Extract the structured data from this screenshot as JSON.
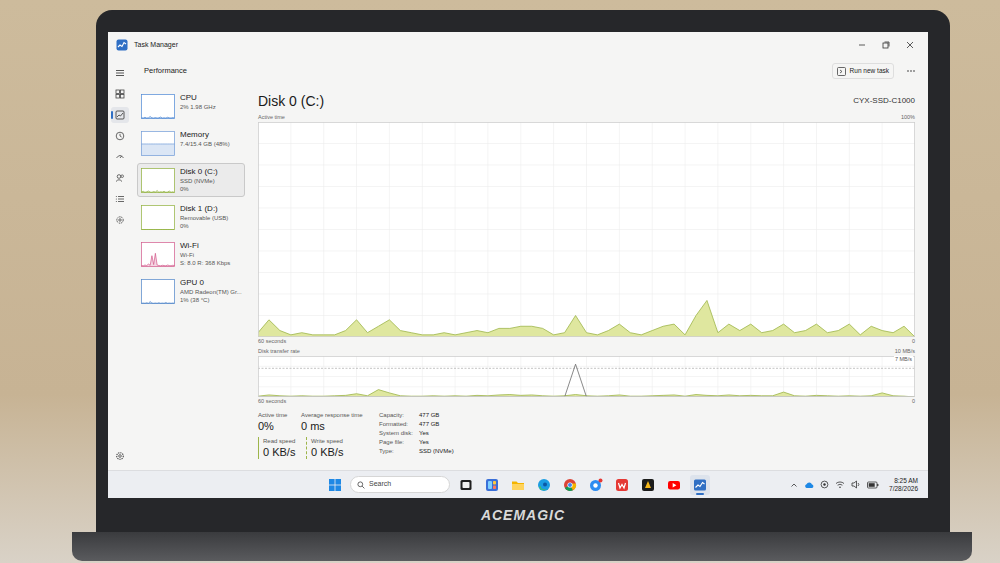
{
  "window": {
    "title": "Task Manager",
    "page": "Performance"
  },
  "nav": [
    {
      "selected": false
    },
    {
      "selected": false
    },
    {
      "selected": true
    },
    {
      "selected": false
    },
    {
      "selected": false
    },
    {
      "selected": false
    },
    {
      "selected": false
    },
    {
      "selected": false
    },
    {
      "selected": false
    }
  ],
  "toolbar": {
    "run_new_task": "Run new task"
  },
  "resources": [
    {
      "name": "CPU",
      "lines": [
        "2% 1.98 GHz"
      ],
      "selected": false,
      "color": "#4a86d4",
      "graph": [
        3,
        2,
        5,
        2,
        3,
        8,
        3,
        2,
        4,
        2,
        3,
        6,
        2,
        3,
        2,
        5,
        3,
        2,
        4,
        2
      ]
    },
    {
      "name": "Memory",
      "lines": [
        "7.4/15.4 GB (48%)"
      ],
      "selected": false,
      "color": "#6f9bd8",
      "graph": [
        48,
        48,
        48,
        48,
        48,
        48,
        48,
        48,
        48,
        48,
        48,
        48,
        48,
        48,
        48,
        48,
        48,
        48,
        48,
        48
      ]
    },
    {
      "name": "Disk 0 (C:)",
      "lines": [
        "SSD (NVMe)",
        "0%"
      ],
      "selected": true,
      "color": "#8fb03a",
      "graph": [
        2,
        5,
        1,
        3,
        6,
        2,
        1,
        4,
        2,
        8,
        1,
        3,
        2,
        5,
        1,
        2,
        6,
        1,
        3,
        0
      ]
    },
    {
      "name": "Disk 1 (D:)",
      "lines": [
        "Removable (USB)",
        "0%"
      ],
      "selected": false,
      "color": "#8fb03a",
      "graph": [
        0,
        0,
        0,
        0,
        0,
        0,
        0,
        0,
        0,
        0,
        0,
        0,
        0,
        0,
        0,
        0,
        0,
        0,
        0,
        0
      ]
    },
    {
      "name": "Wi-Fi",
      "lines": [
        "Wi-Fi",
        "S: 8.0 R: 368 Kbps"
      ],
      "selected": false,
      "color": "#d2578a",
      "graph": [
        4,
        3,
        6,
        4,
        10,
        5,
        45,
        8,
        55,
        6,
        4,
        3,
        5,
        4,
        3,
        6,
        4,
        3,
        5,
        4
      ]
    },
    {
      "name": "GPU 0",
      "lines": [
        "AMD Radeon(TM) Gr...",
        "1% (38 °C)"
      ],
      "selected": false,
      "color": "#4d84c8",
      "graph": [
        1,
        2,
        1,
        3,
        1,
        8,
        2,
        1,
        2,
        1,
        3,
        1,
        2,
        1,
        4,
        1,
        2,
        1,
        2,
        1
      ]
    }
  ],
  "disk": {
    "title": "Disk 0 (C:)",
    "model": "CYX-SSD-C1000",
    "active_chart": {
      "label": "Active time",
      "max": "100%",
      "time": "60 seconds",
      "zero": "0",
      "max_value": 100,
      "values": [
        2,
        8,
        3,
        1,
        2,
        1,
        1,
        1,
        3,
        8,
        2,
        5,
        8,
        3,
        2,
        1,
        1,
        2,
        1,
        2,
        3,
        2,
        4,
        4,
        5,
        5,
        4,
        1,
        2,
        10,
        2,
        1,
        3,
        6,
        2,
        1,
        3,
        5,
        6,
        1,
        10,
        17,
        2,
        6,
        3,
        6,
        2,
        3,
        6,
        2,
        3,
        6,
        2,
        3,
        6,
        1,
        5,
        3,
        2,
        5,
        0
      ]
    },
    "transfer_chart": {
      "label": "Disk transfer rate",
      "max": "10 MB/s",
      "marker": "7 MB/s",
      "marker_value": 7,
      "max_value": 10,
      "time": "60 seconds",
      "zero": "0",
      "read": [
        0.2,
        0.5,
        0.3,
        0.2,
        0.3,
        0.2,
        0.2,
        0.3,
        0.4,
        0.8,
        0.3,
        1.8,
        1.0,
        0.3,
        0.2,
        0.2,
        0.3,
        0.2,
        0.3,
        0.2,
        0.4,
        0.3,
        0.5,
        0.6,
        0.4,
        0.5,
        0.3,
        0.2,
        0.3,
        0.6,
        0.3,
        0.2,
        0.3,
        0.5,
        0.2,
        0.2,
        0.3,
        0.4,
        0.5,
        0.2,
        0.6,
        0.4,
        0.3,
        0.5,
        0.3,
        0.4,
        0.3,
        0.3,
        1.2,
        0.3,
        0.2,
        0.4,
        0.3,
        0.2,
        0.3,
        0.2,
        0.3,
        1.0,
        0.3,
        0.2,
        0
      ],
      "write": [
        0,
        0,
        0,
        0,
        0,
        0,
        0,
        0,
        0,
        0,
        0,
        0,
        0,
        0,
        0,
        0,
        0,
        0,
        0,
        0,
        0,
        0,
        0,
        0,
        0,
        0,
        0,
        0,
        0,
        8,
        0,
        0,
        0,
        0,
        0,
        0,
        0,
        0,
        0,
        0,
        0,
        0,
        0,
        0,
        0,
        0,
        0,
        0,
        0,
        0,
        0,
        0,
        0,
        0,
        0,
        0,
        0,
        0,
        0,
        0,
        0
      ]
    },
    "stats": [
      {
        "label": "Active time",
        "value": "0%"
      },
      {
        "label": "Average response time",
        "value": "0 ms"
      }
    ],
    "speeds": [
      {
        "label": "Read speed",
        "value": "0 KB/s"
      },
      {
        "label": "Write speed",
        "value": "0 KB/s"
      }
    ],
    "properties": [
      {
        "key": "Capacity:",
        "value": "477 GB"
      },
      {
        "key": "Formatted:",
        "value": "477 GB"
      },
      {
        "key": "System disk:",
        "value": "Yes"
      },
      {
        "key": "Page file:",
        "value": "Yes"
      },
      {
        "key": "Type:",
        "value": "SSD (NVMe)"
      }
    ]
  },
  "taskbar": {
    "search": "Search",
    "apps": [
      {
        "active": false
      },
      {
        "active": false
      },
      {
        "active": false
      },
      {
        "active": false
      },
      {
        "active": false
      },
      {
        "active": false
      },
      {
        "active": false
      },
      {
        "active": false
      },
      {
        "active": false
      },
      {
        "active": true
      }
    ],
    "time": "8:25 AM",
    "date": "7/28/2026"
  },
  "laptop": {
    "brand": "ACEMAGIC"
  }
}
